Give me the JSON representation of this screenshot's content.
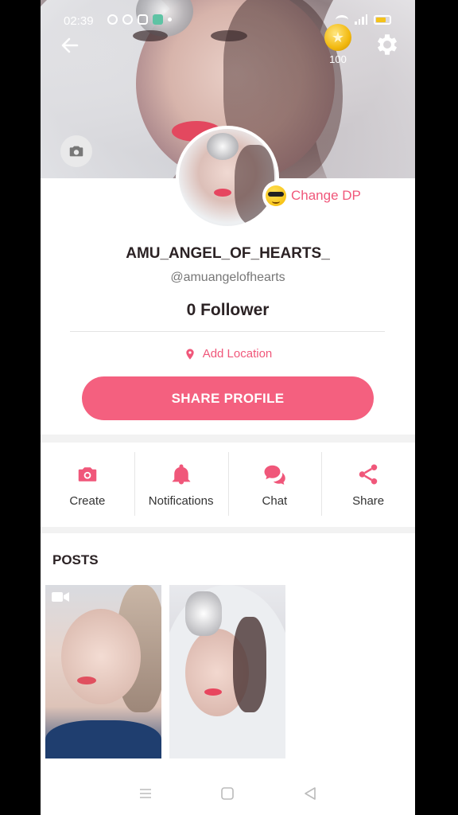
{
  "status_bar": {
    "time": "02:39"
  },
  "wallet": {
    "coins": "100"
  },
  "profile": {
    "change_dp_label": "Change DP",
    "display_name": "AMU_ANGEL_OF_HEARTS_",
    "handle": "@amuangelofhearts",
    "followers": "0 Follower",
    "location_label": "Add Location",
    "share_profile_label": "SHARE PROFILE"
  },
  "actions": [
    {
      "label": "Create",
      "icon": "camera-icon"
    },
    {
      "label": "Notifications",
      "icon": "bell-icon"
    },
    {
      "label": "Chat",
      "icon": "chat-bubbles-icon"
    },
    {
      "label": "Share",
      "icon": "share-icon"
    }
  ],
  "posts": {
    "title": "POSTS",
    "items": [
      {
        "type": "video"
      },
      {
        "type": "photo"
      }
    ]
  },
  "colors": {
    "accent": "#f4607f",
    "accent_text": "#f0577a"
  }
}
